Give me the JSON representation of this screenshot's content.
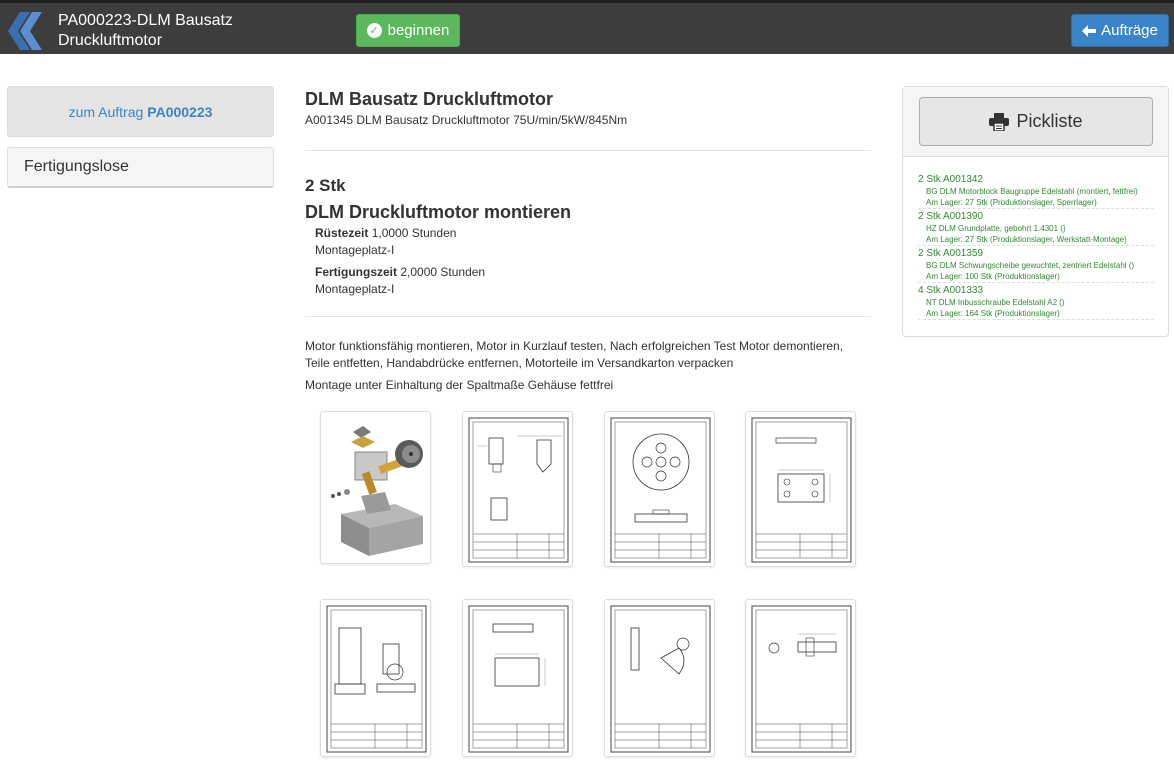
{
  "header": {
    "title_line1": "PA000223-DLM Bausatz",
    "title_line2": "Druckluftmotor",
    "begin_label": "beginnen",
    "orders_label": "Aufträge"
  },
  "sidebar": {
    "order_link_prefix": "zum Auftrag",
    "order_link_number": "PA000223",
    "lots_label": "Fertigungslose"
  },
  "main": {
    "article_title": "DLM Bausatz Druckluftmotor",
    "article_description": "A001345 DLM Bausatz Druckluftmotor 75U/min/5kW/845Nm",
    "quantity": "2 Stk",
    "operation_title": "DLM Druckluftmotor montieren",
    "setup_label": "Rüstezeit",
    "setup_value": "1,0000 Stunden",
    "setup_place": "Montageplatz-I",
    "production_label": "Fertigungszeit",
    "production_value": "2,0000 Stunden",
    "production_place": "Montageplatz-I",
    "instructions_line1": "Motor funktionsfähig montieren, Motor in Kurzlauf testen, Nach erfolgreichen Test Motor demontieren,",
    "instructions_line2": "Teile entfetten, Handabdrücke entfernen, Motorteile im Versandkarton verpacken",
    "instructions_line3": "Montage unter Einhaltung der Spaltmaße Gehäuse fettfrei"
  },
  "pick_panel": {
    "button_label": "Pickliste",
    "items": [
      {
        "qty_line": "2 Stk A001342",
        "name": "BG DLM Motorblock Baugruppe Edelstahl (montiert, fettfrei)",
        "stock": "Am Lager: 27 Stk (Produktionslager, Sperrlager)"
      },
      {
        "qty_line": "2 Stk A001390",
        "name": "HZ DLM Grundplatte, gebohrt 1.4301 ()",
        "stock": "Am Lager: 27 Stk (Produktionslager, Werkstatt-Montage)"
      },
      {
        "qty_line": "2 Stk A001359",
        "name": "BG DLM Schwungscheibe gewuchtet, zentriert Edelstahl ()",
        "stock": "Am Lager: 100 Stk (Produktionslager)"
      },
      {
        "qty_line": "4 Stk A001333",
        "name": "NT DLM Inbusschraube Edelstahl A2 ()",
        "stock": "Am Lager: 164 Stk (Produktionslager)"
      }
    ]
  },
  "drawings": [
    {
      "kind": "3d-assembly-image"
    },
    {
      "kind": "technical-drawing-motorblock"
    },
    {
      "kind": "technical-drawing-schwungscheibe"
    },
    {
      "kind": "technical-drawing-zylinderkopf"
    },
    {
      "kind": "technical-drawing-druckluftmotor"
    },
    {
      "kind": "technical-drawing-grundplatte"
    },
    {
      "kind": "technical-drawing-kurbel"
    },
    {
      "kind": "technical-drawing-kurbelwelle"
    }
  ],
  "colors": {
    "header_bg": "#3d3d3d",
    "success_green": "#5cb85c",
    "primary_blue": "#3a84c9",
    "pick_text_green": "#2e8b2e"
  }
}
